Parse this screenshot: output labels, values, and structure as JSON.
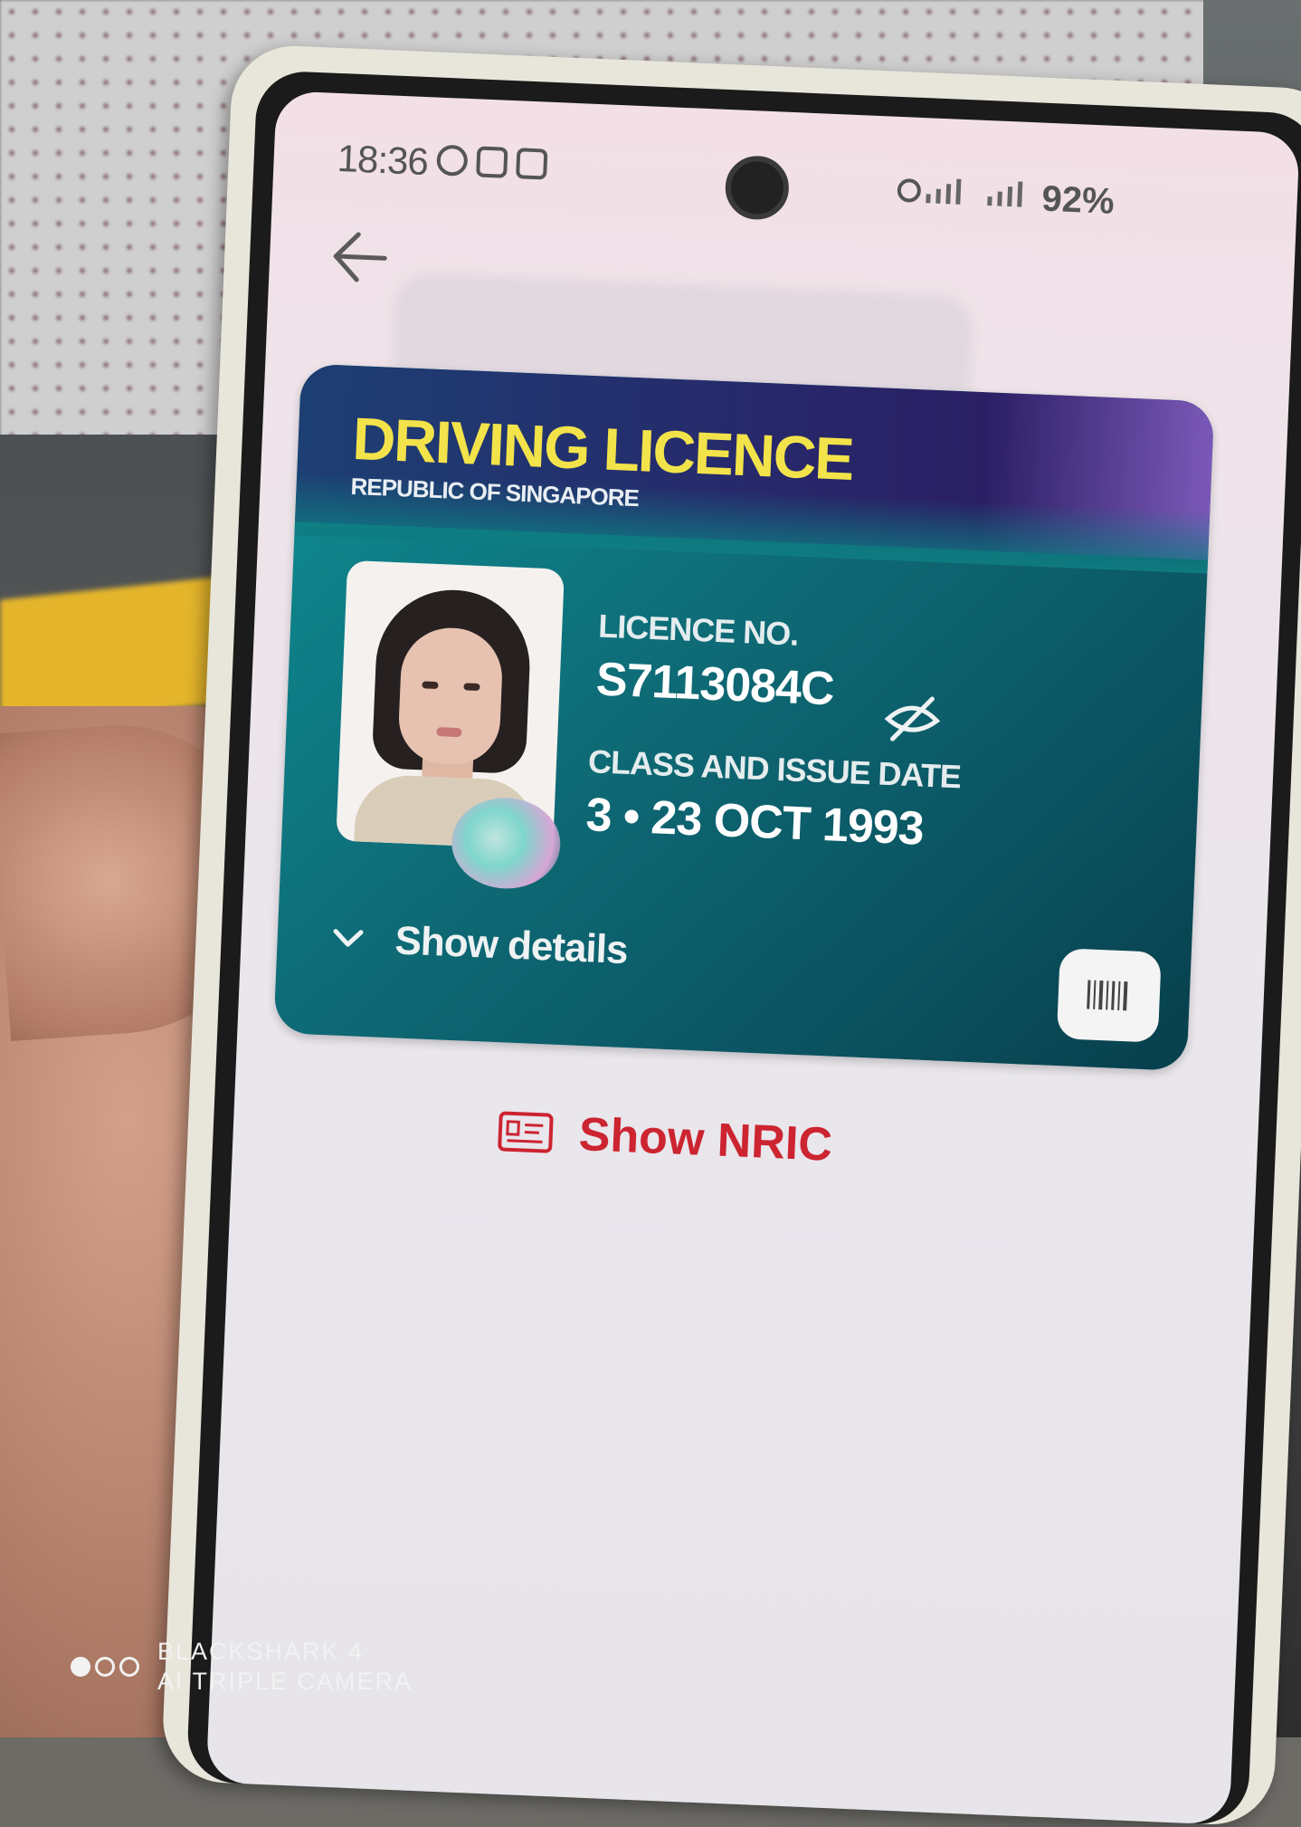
{
  "status_bar": {
    "time": "18:36",
    "battery": "92%"
  },
  "navigation": {
    "back_icon": "arrow-left-icon"
  },
  "licence_card": {
    "title": "DRIVING LICENCE",
    "subtitle": "REPUBLIC OF SINGAPORE",
    "licence_no_label": "LICENCE NO.",
    "licence_no": "S7113084C",
    "class_issue_label": "CLASS AND ISSUE DATE",
    "class_issue_value": "3 • 23 OCT 1993",
    "show_details_label": "Show details",
    "toggle_visibility_icon": "eye-off-icon",
    "barcode_icon": "barcode-icon",
    "colors": {
      "title_yellow": "#f3e34a",
      "card_teal": "#0e6d78",
      "header_navy": "#27296b"
    }
  },
  "nric_button": {
    "label": "Show NRIC",
    "icon": "id-card-icon",
    "color": "#cc2430"
  },
  "camera_watermark": {
    "line1": "BLACKSHARK 4",
    "line2": "AI TRIPLE CAMERA"
  }
}
